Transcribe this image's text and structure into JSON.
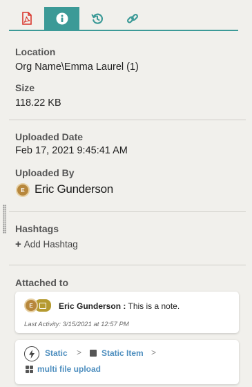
{
  "tabs": [
    {
      "name": "pdf-icon",
      "active": false
    },
    {
      "name": "info-icon",
      "active": true
    },
    {
      "name": "history-icon",
      "active": false
    },
    {
      "name": "link-icon",
      "active": false
    }
  ],
  "details": {
    "location_label": "Location",
    "location_value": "Org Name\\Emma Laurel (1)",
    "size_label": "Size",
    "size_value": "118.22 KB",
    "uploaded_date_label": "Uploaded Date",
    "uploaded_date_value": "Feb 17, 2021 9:45:41 AM",
    "uploaded_by_label": "Uploaded By",
    "uploaded_by_initial": "E",
    "uploaded_by_name": "Eric Gunderson"
  },
  "hashtags": {
    "label": "Hashtags",
    "add_label": "Add Hashtag"
  },
  "attached": {
    "label": "Attached to",
    "note": {
      "avatar_initial": "E",
      "author": "Eric Gunderson :",
      "text": "This is a note.",
      "last_activity": "Last Activity: 3/15/2021 at 12:57 PM"
    },
    "workflow": {
      "crumb1": "Static",
      "crumb2": "Static Item",
      "separator": ">",
      "item": "multi file upload"
    }
  },
  "colors": {
    "accent": "#3c9a97",
    "pdf_red": "#d9342b",
    "link_blue": "#4f8fbf",
    "avatar_bg": "#b7873c"
  }
}
